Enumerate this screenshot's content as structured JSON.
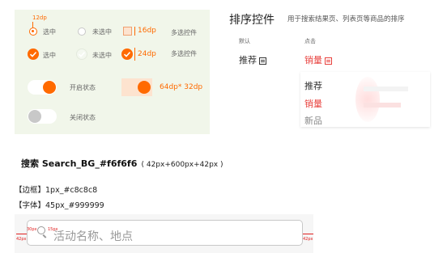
{
  "controls": {
    "size_12": "12dp",
    "checked": "选中",
    "unchecked": "未选中",
    "size_16": "16dp",
    "size_24": "24dp",
    "multi": "多选控件",
    "on_state": "开启状态",
    "off_state": "关闭状态",
    "toggle_size": "64dp* 32dp"
  },
  "sort": {
    "title": "排序控件",
    "desc": "用于搜索结果页、列表页等商品的排序",
    "default_label": "默认",
    "click_label": "点击",
    "recommend": "推荐",
    "sales": "销量",
    "menu": [
      "推荐",
      "销量",
      "新品"
    ],
    "active_color": "#e8413d"
  },
  "search": {
    "heading": "搜索 Search_BG_#f6f6f6",
    "heading_spec": "( 42px+600px+42px )",
    "border": "【边框】1px_#c8c8c8",
    "font": "【字体】45px_#999999",
    "placeholder": "活动名称、地点",
    "mark_42": "42px",
    "mark_30": "30px",
    "mark_15": "15px"
  }
}
